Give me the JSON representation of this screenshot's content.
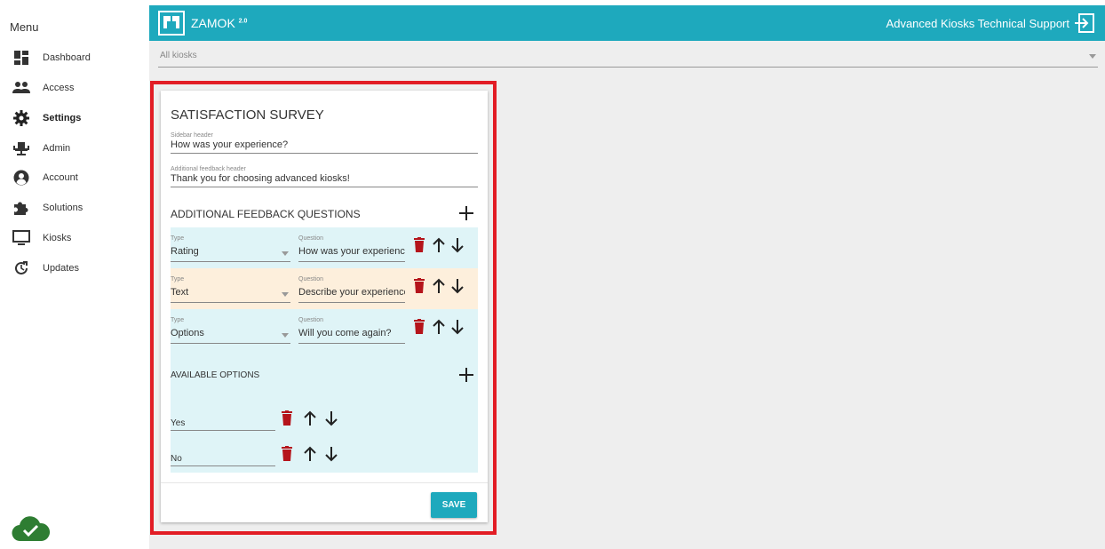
{
  "colors": {
    "topbar": "#1ea9bd",
    "highlight": "#e21d25",
    "rating_bg": "#dff4f7",
    "text_bg": "#fdefdc",
    "options_bg": "#dff4f7",
    "trash": "#b5141b",
    "cloud": "#2e7d32"
  },
  "sidebar": {
    "title": "Menu",
    "items": [
      {
        "label": "Dashboard",
        "icon": "dashboard-icon"
      },
      {
        "label": "Access",
        "icon": "people-icon"
      },
      {
        "label": "Settings",
        "icon": "gear-icon",
        "active": true
      },
      {
        "label": "Admin",
        "icon": "admin-chair-icon"
      },
      {
        "label": "Account",
        "icon": "account-circle-icon"
      },
      {
        "label": "Solutions",
        "icon": "puzzle-icon"
      },
      {
        "label": "Kiosks",
        "icon": "monitor-icon"
      },
      {
        "label": "Updates",
        "icon": "update-icon"
      }
    ],
    "status_icon": "cloud-check-icon"
  },
  "header": {
    "brand": "ZAMOK",
    "brand_badge": "2.0",
    "support_label": "Advanced Kiosks Technical Support",
    "exit_icon": "exit-icon"
  },
  "kiosk_select": {
    "value": "All kiosks"
  },
  "survey": {
    "title": "SATISFACTION SURVEY",
    "sidebar_header": {
      "label": "Sidebar header",
      "value": "How was your experience?"
    },
    "feedback_header": {
      "label": "Additional feedback header",
      "value": "Thank you for choosing advanced kiosks!"
    },
    "questions_title": "ADDITIONAL FEEDBACK QUESTIONS",
    "questions": [
      {
        "type_label": "Type",
        "type": "Rating",
        "question_label": "Question",
        "question": "How was your experience"
      },
      {
        "type_label": "Type",
        "type": "Text",
        "question_label": "Question",
        "question": "Describe your experience."
      },
      {
        "type_label": "Type",
        "type": "Options",
        "question_label": "Question",
        "question": "Will you come again?"
      }
    ],
    "options_title": "AVAILABLE OPTIONS",
    "options": [
      "Yes",
      "No"
    ],
    "save_label": "SAVE"
  }
}
